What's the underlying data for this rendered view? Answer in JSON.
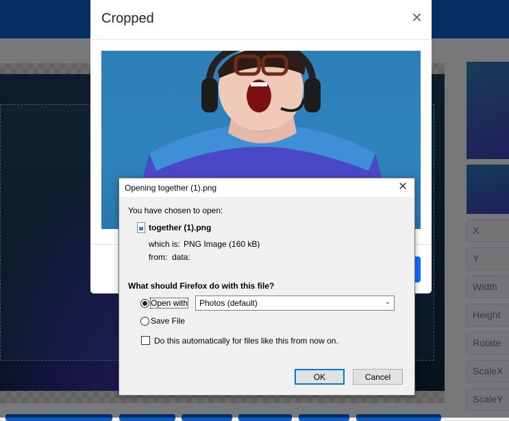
{
  "background": {
    "side_fields": [
      "X",
      "Y",
      "Width",
      "Height",
      "Rotate",
      "ScaleX",
      "ScaleY"
    ]
  },
  "modal": {
    "title": "Cropped",
    "close_glyph": "×"
  },
  "dialog": {
    "title": "Opening together (1).png",
    "close_glyph": "✕",
    "chosen_text": "You have chosen to open:",
    "file_name": "together (1).png",
    "which_is_label": "which is:",
    "which_is_value": "PNG Image (160 kB)",
    "from_label": "from:",
    "from_value": "data:",
    "question": "What should Firefox do with this file?",
    "open_with_label": "Open with",
    "open_with_app": "Photos (default)",
    "save_file_label": "Save File",
    "auto_label": "Do this automatically for files like this from now on.",
    "ok_label": "OK",
    "cancel_label": "Cancel",
    "selected_option": "open_with",
    "auto_checked": false
  },
  "colors": {
    "brand": "#0a5cc4",
    "primary_button": "#0d6efd",
    "default_button_border": "#0078d7"
  }
}
